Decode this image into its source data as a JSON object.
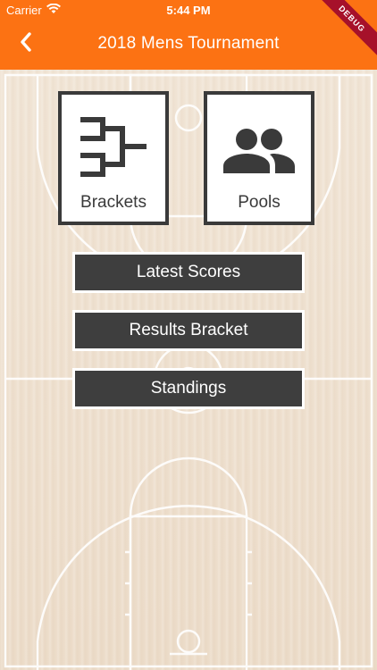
{
  "status_bar": {
    "carrier": "Carrier",
    "time": "5:44 PM"
  },
  "app_bar": {
    "title": "2018 Mens Tournament",
    "background_color": "#fc7213",
    "back_icon": "chevron-left-icon"
  },
  "debug_banner": {
    "label": "DEBUG",
    "color": "#a6112a"
  },
  "tiles": [
    {
      "label": "Brackets",
      "icon": "bracket-icon"
    },
    {
      "label": "Pools",
      "icon": "group-icon"
    }
  ],
  "actions": [
    {
      "label": "Latest Scores"
    },
    {
      "label": "Results Bracket"
    },
    {
      "label": "Standings"
    }
  ],
  "colors": {
    "button_dark": "#3e3e3e",
    "court_wood": "#efe2d2"
  }
}
